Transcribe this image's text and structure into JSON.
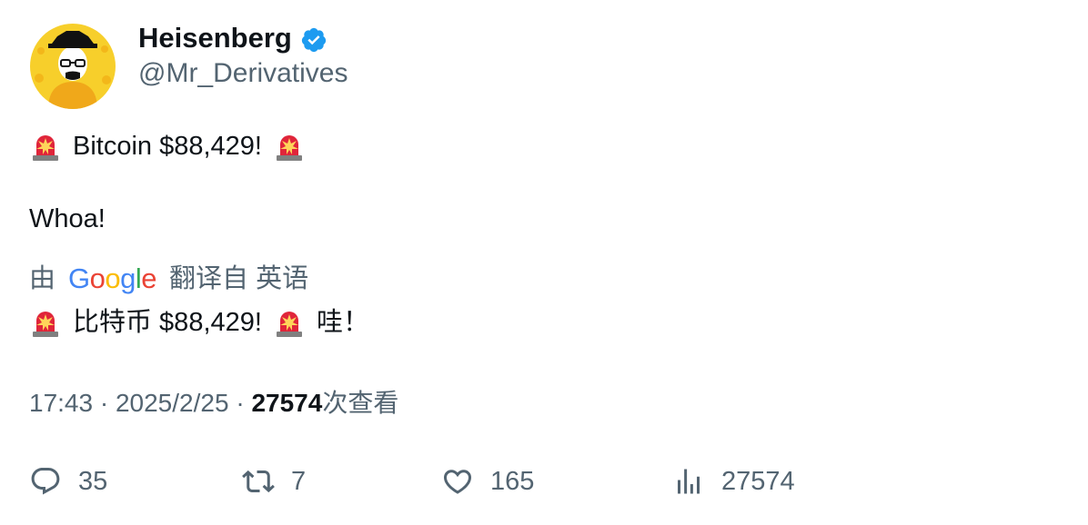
{
  "author": {
    "display_name": "Heisenberg",
    "handle": "@Mr_Derivatives",
    "verified": true,
    "verified_color": "#1d9bf0"
  },
  "tweet": {
    "line1_text": "Bitcoin $88,429!",
    "line2_text": "Whoa!",
    "emoji_icon": "police-car-light-icon"
  },
  "translation": {
    "prefix": "由",
    "provider": "Google",
    "suffix": "翻译自 英语",
    "text_part1": "比特币 $88,429!",
    "text_part2": "哇！"
  },
  "meta": {
    "time": "17:43",
    "separator1": " · ",
    "date": "2025/2/25",
    "separator2": " · ",
    "views": "27574",
    "views_label": "次查看"
  },
  "actions": {
    "replies": "35",
    "retweets": "7",
    "likes": "165",
    "views": "27574"
  },
  "colors": {
    "text_primary": "#0f1419",
    "text_secondary": "#536471",
    "avatar_bg": "#f7cf2b"
  }
}
